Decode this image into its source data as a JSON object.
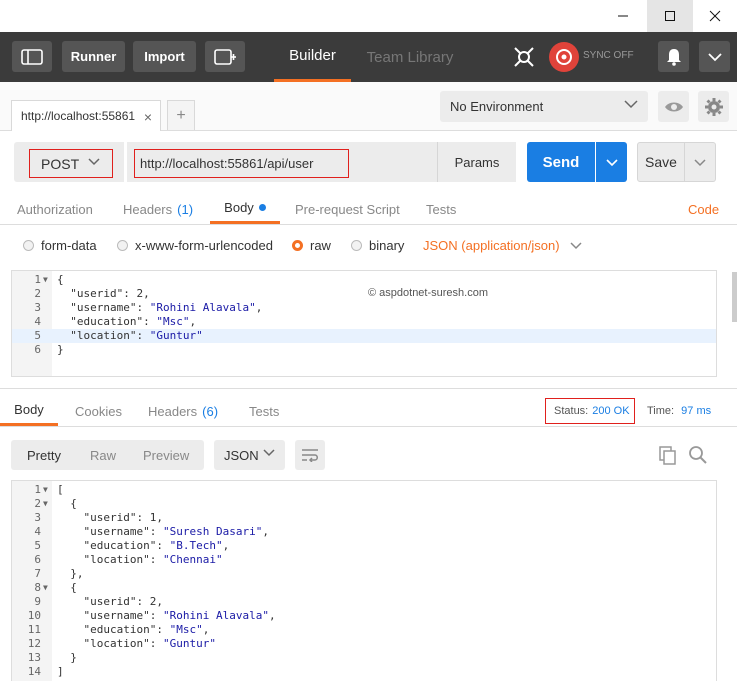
{
  "window": {
    "controls": {
      "minimize": "—",
      "maximize": "☐",
      "close": "✕"
    }
  },
  "toolbar": {
    "runner_label": "Runner",
    "import_label": "Import",
    "builder_label": "Builder",
    "team_library_label": "Team Library",
    "sync_label": "SYNC OFF"
  },
  "tabs": {
    "request_tab_label": "http://localhost:55861",
    "close_symbol": "×",
    "add_symbol": "+"
  },
  "environment": {
    "selected": "No Environment"
  },
  "request": {
    "method": "POST",
    "url": "http://localhost:55861/api/user",
    "params_label": "Params",
    "send_label": "Send",
    "save_label": "Save"
  },
  "request_tabs": {
    "authorization": "Authorization",
    "headers": "Headers",
    "headers_count": "(1)",
    "body": "Body",
    "prerequest": "Pre-request Script",
    "tests": "Tests",
    "code": "Code"
  },
  "body_types": {
    "form_data": "form-data",
    "urlencoded": "x-www-form-urlencoded",
    "raw": "raw",
    "binary": "binary",
    "content_type": "JSON (application/json)",
    "selected": "raw"
  },
  "request_body": {
    "watermark": "© aspdotnet-suresh.com",
    "lines": [
      {
        "num": "1",
        "fold": true,
        "code": "{"
      },
      {
        "num": "2",
        "code": "  \"userid\": 2,"
      },
      {
        "num": "3",
        "code": "  \"username\": \"Rohini Alavala\","
      },
      {
        "num": "4",
        "code": "  \"education\": \"Msc\","
      },
      {
        "num": "5",
        "code": "  \"location\": \"Guntur\"",
        "active": true
      },
      {
        "num": "6",
        "code": "}"
      }
    ]
  },
  "response_tabs": {
    "body": "Body",
    "cookies": "Cookies",
    "headers": "Headers",
    "headers_count": "(6)",
    "tests": "Tests",
    "status_label": "Status:",
    "status_value": "200 OK",
    "time_label": "Time:",
    "time_value": "97 ms"
  },
  "response_view": {
    "pretty": "Pretty",
    "raw": "Raw",
    "preview": "Preview",
    "format": "JSON"
  },
  "response_body": {
    "lines": [
      {
        "num": "1",
        "fold": true,
        "code": "["
      },
      {
        "num": "2",
        "fold": true,
        "code": "  {"
      },
      {
        "num": "3",
        "code": "    \"userid\": 1,"
      },
      {
        "num": "4",
        "code": "    \"username\": \"Suresh Dasari\","
      },
      {
        "num": "5",
        "code": "    \"education\": \"B.Tech\","
      },
      {
        "num": "6",
        "code": "    \"location\": \"Chennai\""
      },
      {
        "num": "7",
        "code": "  },"
      },
      {
        "num": "8",
        "fold": true,
        "code": "  {"
      },
      {
        "num": "9",
        "code": "    \"userid\": 2,"
      },
      {
        "num": "10",
        "code": "    \"username\": \"Rohini Alavala\","
      },
      {
        "num": "11",
        "code": "    \"education\": \"Msc\","
      },
      {
        "num": "12",
        "code": "    \"location\": \"Guntur\""
      },
      {
        "num": "13",
        "code": "  }"
      },
      {
        "num": "14",
        "code": "]"
      }
    ]
  },
  "colors": {
    "accent_orange": "#f47023",
    "send_blue": "#1a7ee3",
    "highlight_red": "#e0201d",
    "toolbar_dark": "#3b3b3b"
  },
  "icons": {
    "sidebar_toggle": "sidebar-icon",
    "new_tab": "new-window-icon",
    "interceptor": "satellite-icon",
    "sync": "sync-icon",
    "notifications": "bell-icon",
    "menu": "chevron-down-icon",
    "environment_quick_look": "eye-icon",
    "settings": "gear-icon",
    "wrap": "wrap-lines-icon",
    "copy": "copy-icon",
    "search": "search-icon"
  }
}
